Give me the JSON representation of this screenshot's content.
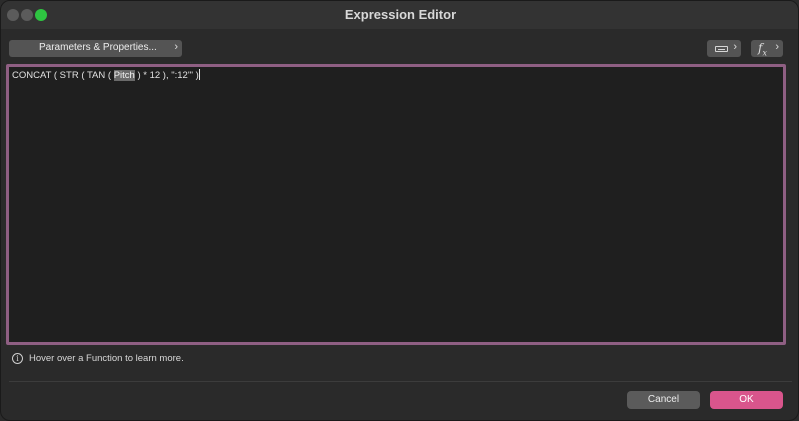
{
  "window": {
    "title": "Expression Editor"
  },
  "toolbar": {
    "params_label": "Parameters & Properties...",
    "params_chevron": "›",
    "keyboard_chevron": "›",
    "fx_chevron": "›",
    "fx_icon_main": "f",
    "fx_icon_sub": "x"
  },
  "editor": {
    "before_selection": "CONCAT ( STR ( TAN ( ",
    "selection": "Pitch",
    "after_selection": " ) * 12 ), \":12'\" )"
  },
  "hint": {
    "icon_glyph": "i",
    "text": "Hover over a Function to learn more."
  },
  "footer": {
    "cancel_label": "Cancel",
    "ok_label": "OK"
  },
  "colors": {
    "accent": "#d9558c",
    "editor_border": "#8f5f83",
    "maximize": "#2ec541"
  }
}
